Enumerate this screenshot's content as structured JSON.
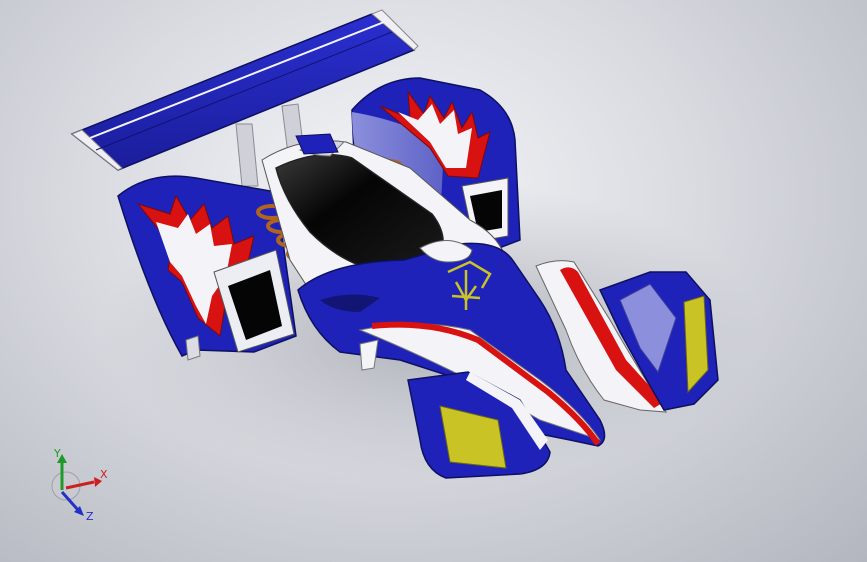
{
  "viewport": {
    "model_colors": {
      "body_blue": "#1f22b8",
      "dark_blue": "#131575",
      "flame_red": "#d81111",
      "white": "#f4f4f8",
      "cockpit": "#0b0b0b",
      "emblem_yellow": "#c9c326",
      "spring_copper": "#b0641f"
    }
  },
  "triad": {
    "x_label": "X",
    "y_label": "Y",
    "z_label": "Z",
    "x_color": "#cc1f1f",
    "y_color": "#1f9a2a",
    "z_color": "#2430c8"
  }
}
